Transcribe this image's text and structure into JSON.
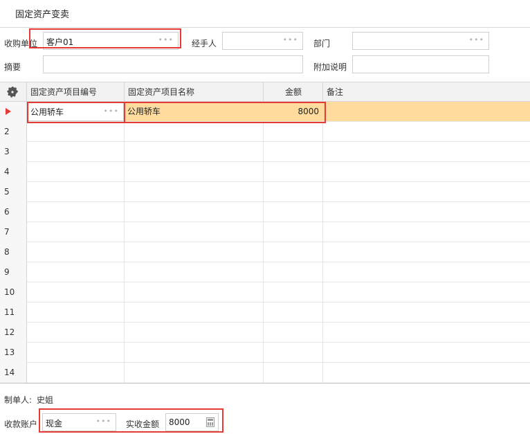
{
  "title": "固定资产变卖",
  "form": {
    "buyer_label": "收购单位",
    "buyer_value": "客户01",
    "handler_label": "经手人",
    "handler_value": "",
    "dept_label": "部门",
    "dept_value": "",
    "summary_label": "摘要",
    "summary_value": "",
    "note_label": "附加说明",
    "note_value": ""
  },
  "grid": {
    "columns": [
      "固定资产项目编号",
      "固定资产项目名称",
      "金额",
      "备注"
    ],
    "rows": [
      {
        "num": "1",
        "code": "公用轿车",
        "name": "公用轿车",
        "amount": "8000",
        "remark": ""
      },
      {
        "num": "2"
      },
      {
        "num": "3"
      },
      {
        "num": "4"
      },
      {
        "num": "5"
      },
      {
        "num": "6"
      },
      {
        "num": "7"
      },
      {
        "num": "8"
      },
      {
        "num": "9"
      },
      {
        "num": "10"
      },
      {
        "num": "11"
      },
      {
        "num": "12"
      },
      {
        "num": "13"
      },
      {
        "num": "14"
      }
    ]
  },
  "footer": {
    "creator_label": "制单人:",
    "creator_value": "史姐",
    "account_label": "收款账户",
    "account_value": "现金",
    "received_label": "实收金额",
    "received_value": "8000"
  },
  "icons": {
    "settings": "gear-icon",
    "lookup": "ellipsis-icon",
    "calculator": "calculator-icon",
    "current_row": "row-pointer-icon"
  },
  "colors": {
    "highlight": "#e53935",
    "selected_row": "#ffdc9e",
    "border": "#d6d6d6"
  }
}
